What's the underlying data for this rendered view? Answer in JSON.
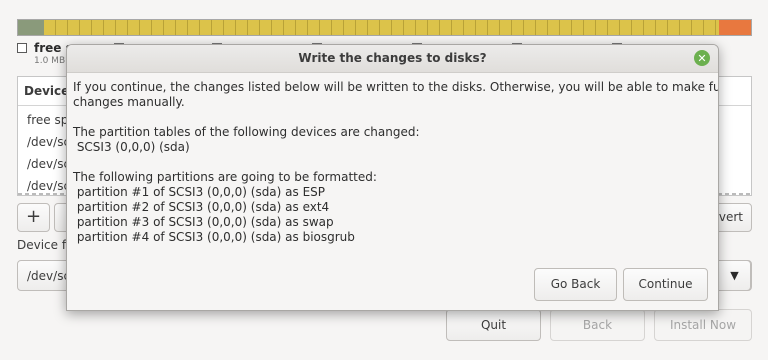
{
  "background": {
    "partition_legend": {
      "label": "free s",
      "size": "1.0 MB"
    },
    "table": {
      "column_device": "Device",
      "rows": [
        "free sp",
        "/dev/sc",
        "/dev/sc",
        "/dev/sc"
      ]
    },
    "buttons": {
      "add": "+",
      "remove": "-",
      "revert": "vert"
    },
    "device_boot_label": "Device fo",
    "device_boot_value": "/dev/sc",
    "footer": {
      "quit": "Quit",
      "back": "Back",
      "install_now": "Install Now"
    }
  },
  "dialog": {
    "title": "Write the changes to disks?",
    "intro_line1": "If you continue, the changes listed below will be written to the disks. Otherwise, you will be able to make further",
    "intro_line2": "changes manually.",
    "tables_heading": "The partition tables of the following devices are changed:",
    "tables_device": " SCSI3 (0,0,0) (sda)",
    "formatted_heading": "The following partitions are going to be formatted:",
    "formatted": [
      " partition #1 of SCSI3 (0,0,0) (sda) as ESP",
      " partition #2 of SCSI3 (0,0,0) (sda) as ext4",
      " partition #3 of SCSI3 (0,0,0) (sda) as swap",
      " partition #4 of SCSI3 (0,0,0) (sda) as biosgrub"
    ],
    "go_back": "Go Back",
    "continue": "Continue"
  },
  "colors": {
    "free_space": "#8a9a7b",
    "ext4": "#dcc34a",
    "swap": "#e8783f",
    "close_button": "#6cb04f"
  }
}
